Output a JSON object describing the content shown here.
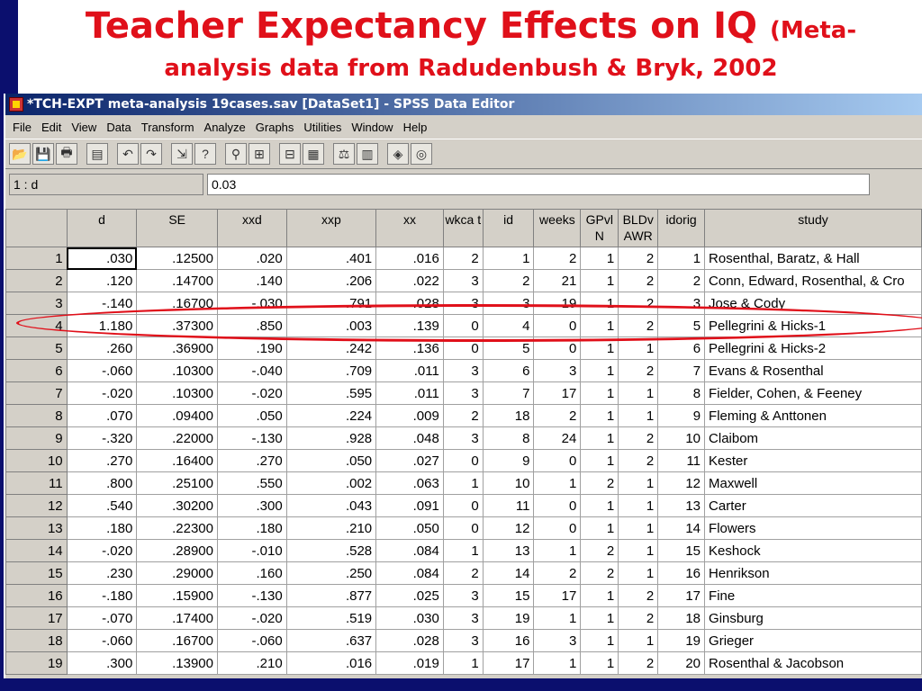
{
  "slide": {
    "title_main": "Teacher Expectancy Effects on IQ",
    "title_paren": "(Meta-",
    "title_line2": "analysis data from Radudenbush & Bryk, 2002"
  },
  "window": {
    "title": "*TCH-EXPT meta-analysis 19cases.sav [DataSet1] - SPSS Data Editor"
  },
  "menu": [
    "File",
    "Edit",
    "View",
    "Data",
    "Transform",
    "Analyze",
    "Graphs",
    "Utilities",
    "Window",
    "Help"
  ],
  "toolbar_icons": [
    "open-icon",
    "save-icon",
    "print-icon",
    "dialog-recall-icon",
    "undo-icon",
    "redo-icon",
    "goto-case-icon",
    "variables-icon",
    "find-icon",
    "insert-cases-icon",
    "insert-variable-icon",
    "split-file-icon",
    "weight-cases-icon",
    "select-cases-icon",
    "value-labels-icon",
    "use-sets-icon"
  ],
  "cell_editor": {
    "name": "1 : d",
    "value": "0.03"
  },
  "columns": [
    "d",
    "SE",
    "xxd",
    "xxp",
    "xx",
    "wkca t",
    "id",
    "weeks",
    "GPvl N",
    "BLDv AWR",
    "idorig",
    "study"
  ],
  "rows": [
    [
      "1",
      ".030",
      ".12500",
      ".020",
      ".401",
      ".016",
      "2",
      "1",
      "2",
      "1",
      "2",
      "1",
      "Rosenthal, Baratz, & Hall"
    ],
    [
      "2",
      ".120",
      ".14700",
      ".140",
      ".206",
      ".022",
      "3",
      "2",
      "21",
      "1",
      "2",
      "2",
      "Conn, Edward, Rosenthal, & Cro"
    ],
    [
      "3",
      "-.140",
      ".16700",
      "-.030",
      ".791",
      ".028",
      "3",
      "3",
      "19",
      "1",
      "2",
      "3",
      "Jose & Cody"
    ],
    [
      "4",
      "1.180",
      ".37300",
      ".850",
      ".003",
      ".139",
      "0",
      "4",
      "0",
      "1",
      "2",
      "5",
      "Pellegrini & Hicks-1"
    ],
    [
      "5",
      ".260",
      ".36900",
      ".190",
      ".242",
      ".136",
      "0",
      "5",
      "0",
      "1",
      "1",
      "6",
      "Pellegrini & Hicks-2"
    ],
    [
      "6",
      "-.060",
      ".10300",
      "-.040",
      ".709",
      ".011",
      "3",
      "6",
      "3",
      "1",
      "2",
      "7",
      "Evans & Rosenthal"
    ],
    [
      "7",
      "-.020",
      ".10300",
      "-.020",
      ".595",
      ".011",
      "3",
      "7",
      "17",
      "1",
      "1",
      "8",
      "Fielder, Cohen, & Feeney"
    ],
    [
      "8",
      ".070",
      ".09400",
      ".050",
      ".224",
      ".009",
      "2",
      "18",
      "2",
      "1",
      "1",
      "9",
      "Fleming & Anttonen"
    ],
    [
      "9",
      "-.320",
      ".22000",
      "-.130",
      ".928",
      ".048",
      "3",
      "8",
      "24",
      "1",
      "2",
      "10",
      "Claibom"
    ],
    [
      "10",
      ".270",
      ".16400",
      ".270",
      ".050",
      ".027",
      "0",
      "9",
      "0",
      "1",
      "2",
      "11",
      "Kester"
    ],
    [
      "11",
      ".800",
      ".25100",
      ".550",
      ".002",
      ".063",
      "1",
      "10",
      "1",
      "2",
      "1",
      "12",
      "Maxwell"
    ],
    [
      "12",
      ".540",
      ".30200",
      ".300",
      ".043",
      ".091",
      "0",
      "11",
      "0",
      "1",
      "1",
      "13",
      "Carter"
    ],
    [
      "13",
      ".180",
      ".22300",
      ".180",
      ".210",
      ".050",
      "0",
      "12",
      "0",
      "1",
      "1",
      "14",
      "Flowers"
    ],
    [
      "14",
      "-.020",
      ".28900",
      "-.010",
      ".528",
      ".084",
      "1",
      "13",
      "1",
      "2",
      "1",
      "15",
      "Keshock"
    ],
    [
      "15",
      ".230",
      ".29000",
      ".160",
      ".250",
      ".084",
      "2",
      "14",
      "2",
      "2",
      "1",
      "16",
      "Henrikson"
    ],
    [
      "16",
      "-.180",
      ".15900",
      "-.130",
      ".877",
      ".025",
      "3",
      "15",
      "17",
      "1",
      "2",
      "17",
      "Fine"
    ],
    [
      "17",
      "-.070",
      ".17400",
      "-.020",
      ".519",
      ".030",
      "3",
      "19",
      "1",
      "1",
      "2",
      "18",
      "Ginsburg"
    ],
    [
      "18",
      "-.060",
      ".16700",
      "-.060",
      ".637",
      ".028",
      "3",
      "16",
      "3",
      "1",
      "1",
      "19",
      "Grieger"
    ],
    [
      "19",
      ".300",
      ".13900",
      ".210",
      ".016",
      ".019",
      "1",
      "17",
      "1",
      "1",
      "2",
      "20",
      "Rosenthal & Jacobson"
    ]
  ],
  "highlight_color": "#e0101a"
}
